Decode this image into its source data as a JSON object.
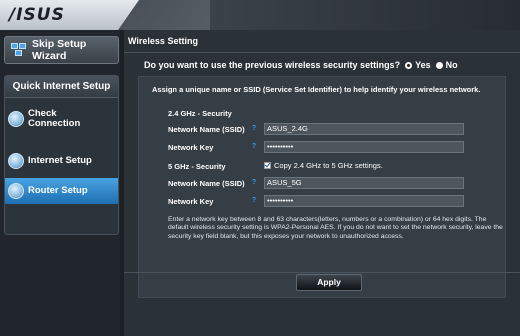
{
  "brand": {
    "logo_text": "/ISUS"
  },
  "sidebar": {
    "wizard_label": "Skip Setup Wizard",
    "qis_title": "Quick Internet Setup",
    "steps": [
      {
        "label": "Check Connection",
        "active": false
      },
      {
        "label": "Internet Setup",
        "active": false
      },
      {
        "label": "Router Setup",
        "active": true
      }
    ]
  },
  "main": {
    "title": "Wireless Setting",
    "question": "Do you want to use the previous wireless security settings?",
    "yes_label": "Yes",
    "no_label": "No",
    "selected": "yes",
    "assign_text": "Assign a unique name or SSID (Service Set Identifier) to help identify your wireless network.",
    "band_24": {
      "title": "2.4 GHz - Security",
      "ssid_label": "Network Name (SSID)",
      "ssid_value": "ASUS_2.4G",
      "key_label": "Network Key",
      "key_value": "••••••••••"
    },
    "band_5": {
      "title": "5 GHz - Security",
      "copy_label": "Copy 2.4 GHz to 5 GHz settings.",
      "copy_checked": true,
      "ssid_label": "Network Name (SSID)",
      "ssid_value": "ASUS_5G",
      "key_label": "Network Key",
      "key_value": "••••••••••"
    },
    "note": "Enter a network key between 8 and 63 characters(letters, numbers or a combination) or 64 hex digits. The default wireless security setting is WPA2-Personal AES. If you do not want to set the network security, leave the security key field blank, but this exposes your network to unauthorized access.",
    "apply_label": "Apply"
  },
  "colors": {
    "accent": "#2a8be0",
    "active_step": "#1e6fb1",
    "help_icon": "#2c9cf0"
  },
  "icons": {
    "wizard": "network-wizard-icon",
    "step": "step-circle-icon",
    "help": "help-icon"
  }
}
